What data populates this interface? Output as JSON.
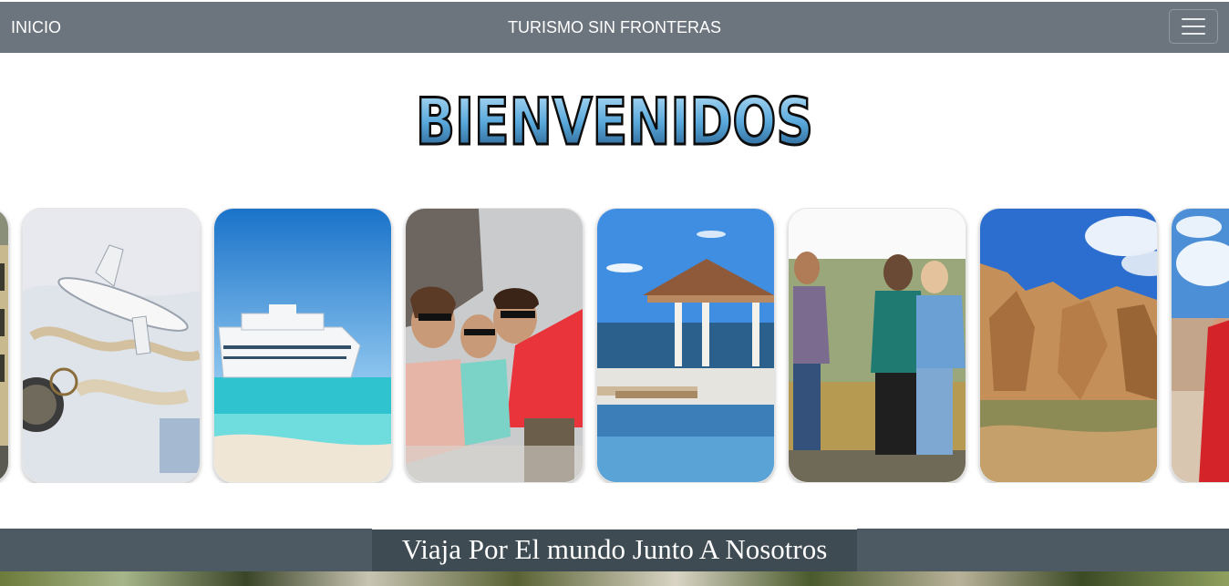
{
  "navbar": {
    "brand_label": "INICIO",
    "title": "TURISMO SIN FRONTERAS",
    "toggler_icon": "hamburger-menu-icon"
  },
  "hero": {
    "welcome_text": "BIENVENIDOS"
  },
  "carousel": {
    "cards": [
      {
        "name": "city-street-photo"
      },
      {
        "name": "airplane-map-photo"
      },
      {
        "name": "cruise-ship-beach-photo"
      },
      {
        "name": "friends-selfie-photo"
      },
      {
        "name": "poolside-gazebo-photo"
      },
      {
        "name": "backpackers-hiking-photo"
      },
      {
        "name": "rock-formations-photo"
      },
      {
        "name": "woman-red-dress-photo"
      }
    ]
  },
  "banner": {
    "text": "Viaja Por El mundo Junto A Nosotros"
  },
  "colors": {
    "navbar": "#6c757d",
    "banner": "#4d5a63",
    "welcome_fill": "#5aa9dc"
  }
}
